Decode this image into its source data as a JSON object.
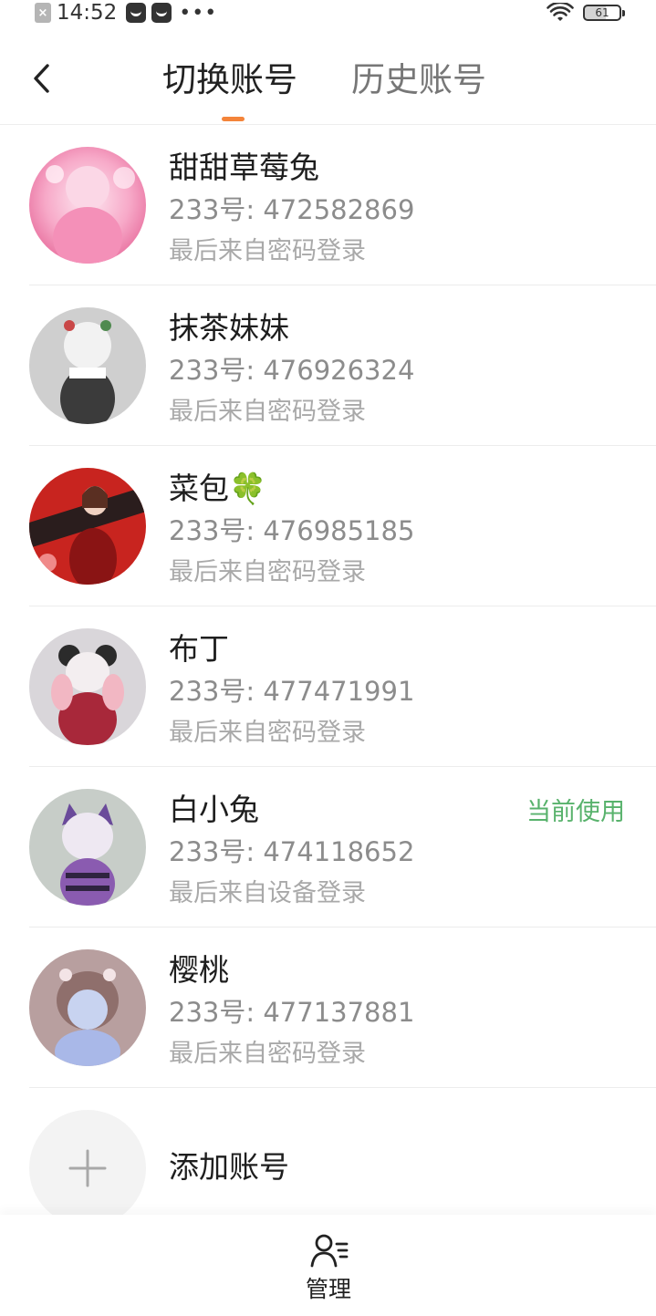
{
  "status_bar": {
    "time": "14:52",
    "battery": "61",
    "close_glyph": "×",
    "more_glyph": "•••"
  },
  "header": {
    "tabs": [
      {
        "label": "切换账号",
        "active": true
      },
      {
        "label": "历史账号",
        "active": false
      }
    ],
    "accent_color": "#f4843a"
  },
  "accounts": [
    {
      "name": "甜甜草莓兔",
      "id_line": "233号: 472582869",
      "login": "最后来自密码登录",
      "current": ""
    },
    {
      "name": "抹茶妹妹",
      "id_line": "233号: 476926324",
      "login": "最后来自密码登录",
      "current": ""
    },
    {
      "name": "菜包🍀",
      "id_line": "233号: 476985185",
      "login": "最后来自密码登录",
      "current": ""
    },
    {
      "name": "布丁",
      "id_line": "233号: 477471991",
      "login": "最后来自密码登录",
      "current": ""
    },
    {
      "name": "白小兔",
      "id_line": "233号: 474118652",
      "login": "最后来自设备登录",
      "current": "当前使用"
    },
    {
      "name": "樱桃",
      "id_line": "233号: 477137881",
      "login": "最后来自密码登录",
      "current": ""
    }
  ],
  "add_account": {
    "label": "添加账号",
    "icon": "plus-icon"
  },
  "bottom_bar": {
    "manage_label": "管理",
    "icon": "user-list-icon"
  },
  "colors": {
    "current_badge": "#58b26c",
    "secondary_text": "#8c8c8c",
    "tertiary_text": "#a9a9a9"
  }
}
